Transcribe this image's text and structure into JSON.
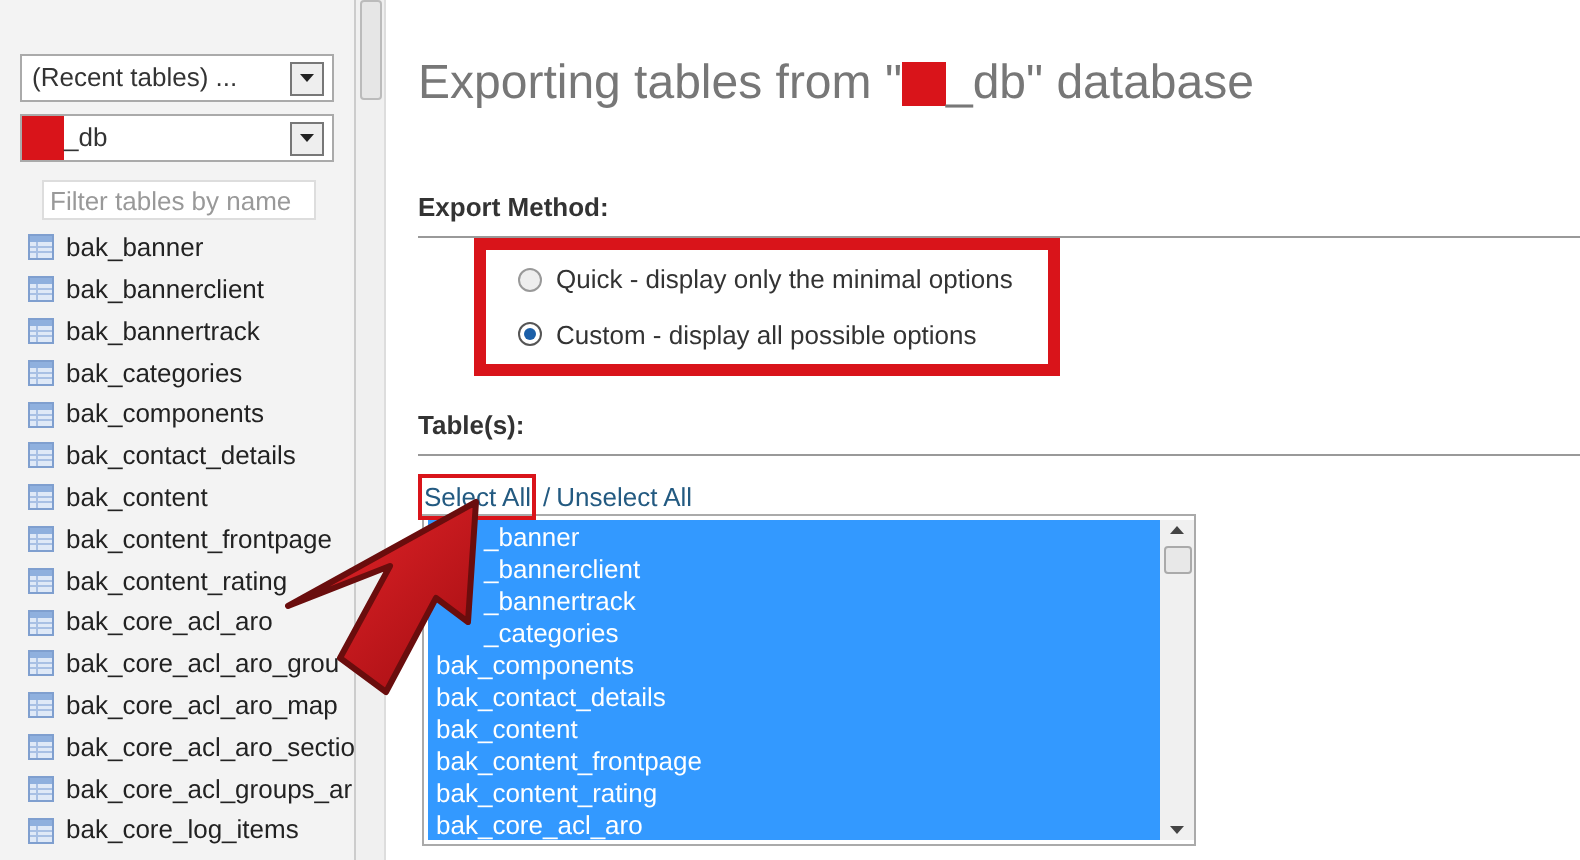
{
  "sidebar": {
    "recent_select": {
      "value": "(Recent tables) ..."
    },
    "db_select": {
      "value": "_db",
      "redacted": true
    },
    "filter": {
      "placeholder": "Filter tables by name"
    },
    "items": [
      "bak_banner",
      "bak_bannerclient",
      "bak_bannertrack",
      "bak_categories",
      "bak_components",
      "bak_contact_details",
      "bak_content",
      "bak_content_frontpage",
      "bak_content_rating",
      "bak_core_acl_aro",
      "bak_core_acl_aro_grou",
      "bak_core_acl_aro_map",
      "bak_core_acl_aro_sectio",
      "bak_core_acl_groups_ar",
      "bak_core_log_items"
    ]
  },
  "title": {
    "prefix": "Exporting tables from \"",
    "suffix": "_db\" database",
    "redacted": true
  },
  "export_method": {
    "heading": "Export Method:",
    "highlighted": true,
    "options": [
      {
        "label": "Quick - display only the minimal options",
        "selected": false
      },
      {
        "label": "Custom - display all possible options",
        "selected": true
      }
    ]
  },
  "tables": {
    "heading": "Table(s):",
    "select_all": "Select All",
    "separator": "/",
    "unselect_all": "Unselect All",
    "select_all_highlighted": true,
    "items": [
      {
        "label": "_banner",
        "selected": true,
        "covered": true
      },
      {
        "label": "_bannerclient",
        "selected": true,
        "covered": true
      },
      {
        "label": "_bannertrack",
        "selected": true,
        "covered": true
      },
      {
        "label": "_categories",
        "selected": true,
        "covered": true
      },
      {
        "label": "bak_components",
        "selected": true,
        "covered": false
      },
      {
        "label": "bak_contact_details",
        "selected": true,
        "covered": false
      },
      {
        "label": "bak_content",
        "selected": true,
        "covered": false
      },
      {
        "label": "bak_content_frontpage",
        "selected": true,
        "covered": false
      },
      {
        "label": "bak_content_rating",
        "selected": true,
        "covered": false
      },
      {
        "label": "bak_core_acl_aro",
        "selected": true,
        "covered": false
      }
    ]
  },
  "annotation": {
    "kind": "arrow"
  }
}
